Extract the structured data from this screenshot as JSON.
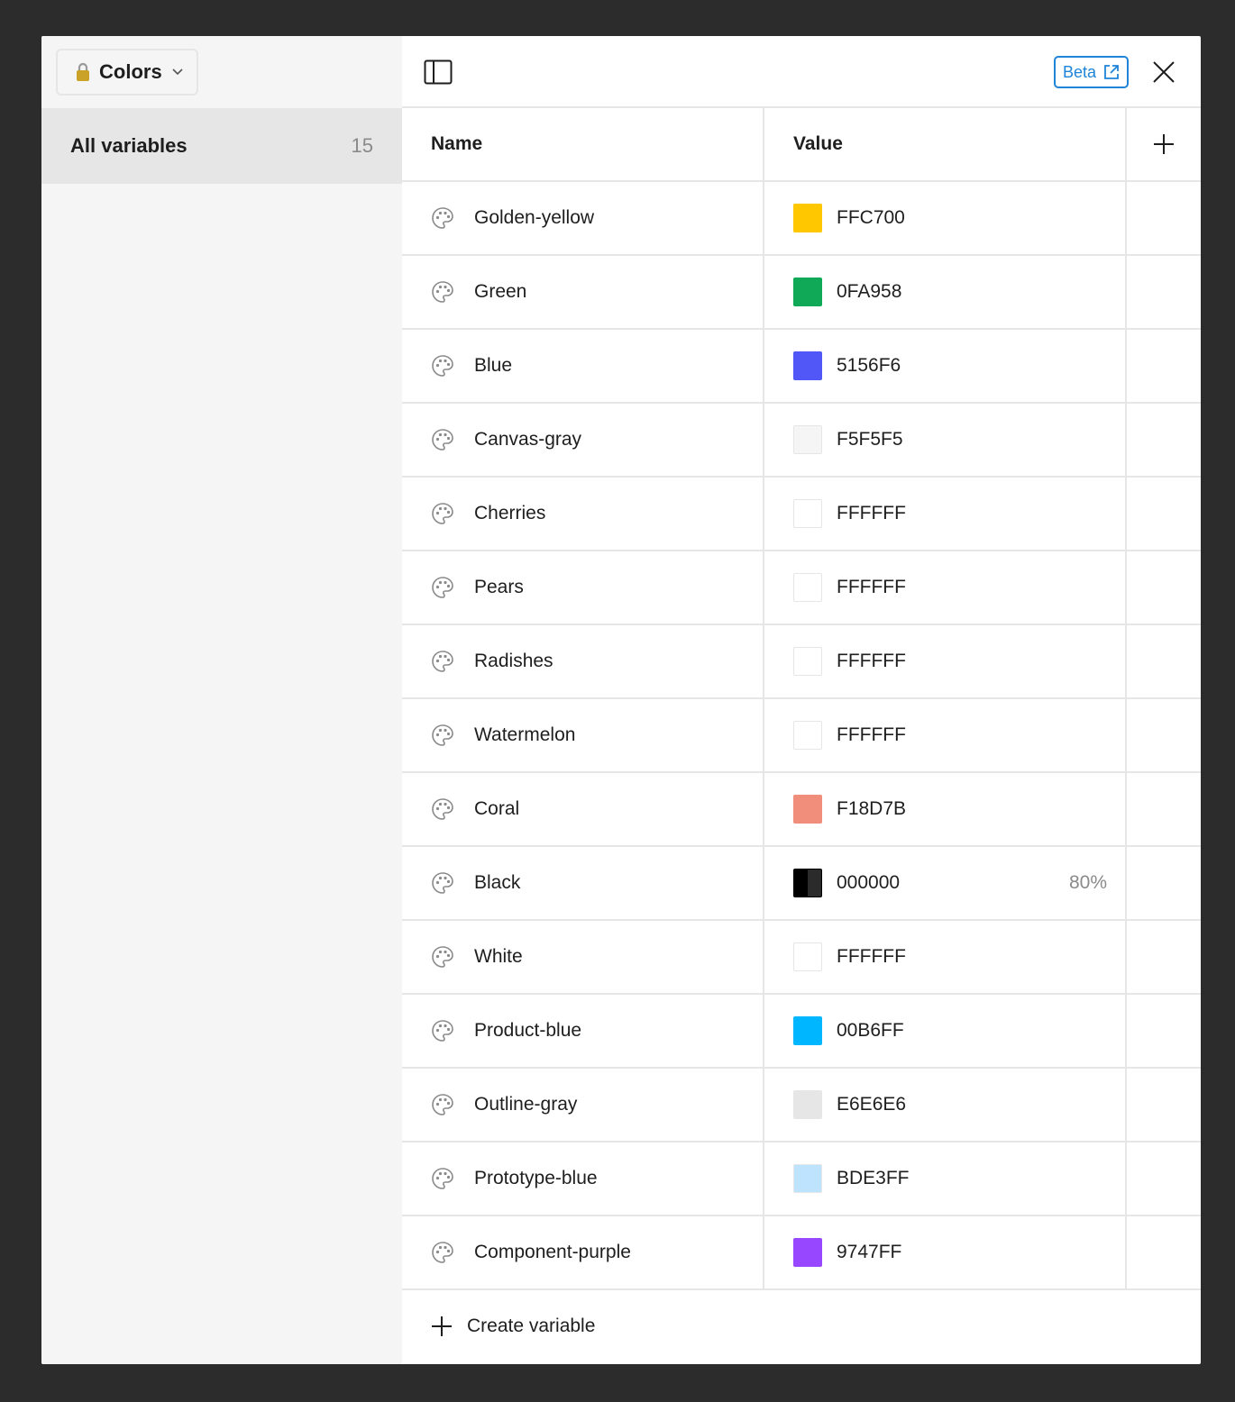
{
  "sidebar": {
    "collection_label": "Colors",
    "group": {
      "label": "All variables",
      "count": "15"
    }
  },
  "topbar": {
    "beta_label": "Beta"
  },
  "table": {
    "headers": {
      "name": "Name",
      "value": "Value"
    },
    "rows": [
      {
        "name": "Golden-yellow",
        "value": "FFC700",
        "color": "#FFC700",
        "opacity": ""
      },
      {
        "name": "Green",
        "value": "0FA958",
        "color": "#0FA958",
        "opacity": ""
      },
      {
        "name": "Blue",
        "value": "5156F6",
        "color": "#5156F6",
        "opacity": ""
      },
      {
        "name": "Canvas-gray",
        "value": "F5F5F5",
        "color": "#F5F5F5",
        "opacity": ""
      },
      {
        "name": "Cherries",
        "value": "FFFFFF",
        "color": "#FFFFFF",
        "opacity": ""
      },
      {
        "name": "Pears",
        "value": "FFFFFF",
        "color": "#FFFFFF",
        "opacity": ""
      },
      {
        "name": "Radishes",
        "value": "FFFFFF",
        "color": "#FFFFFF",
        "opacity": ""
      },
      {
        "name": "Watermelon",
        "value": "FFFFFF",
        "color": "#FFFFFF",
        "opacity": ""
      },
      {
        "name": "Coral",
        "value": "F18D7B",
        "color": "#F18D7B",
        "opacity": ""
      },
      {
        "name": "Black",
        "value": "000000",
        "color": "#000000",
        "opacity": "80%"
      },
      {
        "name": "White",
        "value": "FFFFFF",
        "color": "#FFFFFF",
        "opacity": ""
      },
      {
        "name": "Product-blue",
        "value": "00B6FF",
        "color": "#00B6FF",
        "opacity": ""
      },
      {
        "name": "Outline-gray",
        "value": "E6E6E6",
        "color": "#E6E6E6",
        "opacity": ""
      },
      {
        "name": "Prototype-blue",
        "value": "BDE3FF",
        "color": "#BDE3FF",
        "opacity": ""
      },
      {
        "name": "Component-purple",
        "value": "9747FF",
        "color": "#9747FF",
        "opacity": ""
      }
    ]
  },
  "footer": {
    "create_label": "Create variable"
  }
}
